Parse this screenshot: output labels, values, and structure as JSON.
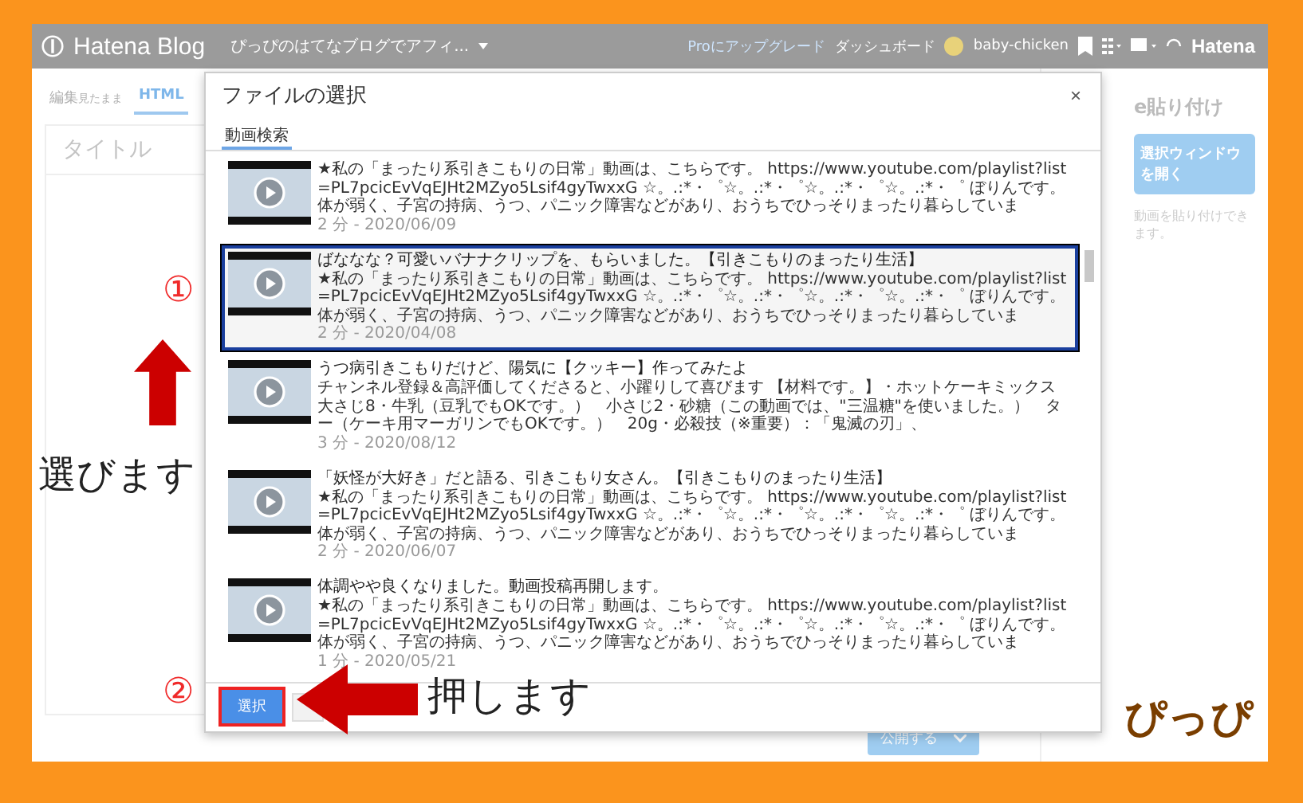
{
  "top_bar": {
    "logo": "Hatena Blog",
    "blog_title": "ぴっぴのはてなブログでアフィ...",
    "upgrade_link": "Proにアップグレード",
    "dashboard_link": "ダッシュボード",
    "user": "baby-chicken",
    "brand": "Hatena"
  },
  "editor": {
    "mode_tabs": [
      {
        "label": "編集",
        "sub": "見たまま",
        "selected": false
      },
      {
        "label": "HTML",
        "selected": true
      }
    ],
    "title_placeholder": "タイトル"
  },
  "side_panel": {
    "heading": "e貼り付け",
    "button": "選択ウィンドウを開く",
    "note": "動画を貼り付けできます。"
  },
  "publish_button": "公開する",
  "dialog": {
    "title": "ファイルの選択",
    "close": "×",
    "tabs": [
      {
        "label": "動画検索",
        "selected": true
      }
    ],
    "videos": [
      {
        "description": "★私の「まったり系引きこもりの日常」動画は、こちらです。 https://www.youtube.com/playlist?list=PL7pcicEvVqEJHt2MZyo5Lsif4gyTwxxG ☆。.:*・゜☆。.:*・゜☆。.:*・゜☆。.:*・゜ ぼりんです。体が弱く、子宮の持病、うつ、パニック障害などがあり、おうちでひっそりまったり暮らしていま",
        "meta": "2 分 - 2020/06/09",
        "selected": false
      },
      {
        "title": "ばななな？可愛いバナナクリップを、もらいました。【引きこもりのまったり生活】",
        "description": "★私の「まったり系引きこもりの日常」動画は、こちらです。 https://www.youtube.com/playlist?list=PL7pcicEvVqEJHt2MZyo5Lsif4gyTwxxG ☆。.:*・゜☆。.:*・゜☆。.:*・゜☆。.:*・゜ ぼりんです。体が弱く、子宮の持病、うつ、パニック障害などがあり、おうちでひっそりまったり暮らしていま",
        "meta": "2 分 - 2020/04/08",
        "selected": true
      },
      {
        "title": "うつ病引きこもりだけど、陽気に【クッキー】作ってみたよ",
        "description": "チャンネル登録＆高評価してくださると、小躍りして喜びます 【材料です。】・ホットケーキミックス大さじ8・牛乳（豆乳でもOKです。）　小さじ2・砂糖（この動画では、\"三温糖\"を使いました。）　ター（ケーキ用マーガリンでもOKです。）　20g・必殺技（※重要）：「鬼滅の刃」、",
        "meta": "3 分 - 2020/08/12",
        "selected": false
      },
      {
        "title": "「妖怪が大好き」だと語る、引きこもり女さん。【引きこもりのまったり生活】",
        "description": "★私の「まったり系引きこもりの日常」動画は、こちらです。 https://www.youtube.com/playlist?list=PL7pcicEvVqEJHt2MZyo5Lsif4gyTwxxG ☆。.:*・゜☆。.:*・゜☆。.:*・゜☆。.:*・゜ ぼりんです。体が弱く、子宮の持病、うつ、パニック障害などがあり、おうちでひっそりまったり暮らしていま",
        "meta": "2 分 - 2020/06/07",
        "selected": false
      },
      {
        "title": "体調やや良くなりました。動画投稿再開します。",
        "description": "★私の「まったり系引きこもりの日常」動画は、こちらです。 https://www.youtube.com/playlist?list=PL7pcicEvVqEJHt2MZyo5Lsif4gyTwxxG ☆。.:*・゜☆。.:*・゜☆。.:*・゜☆。.:*・゜ ぼりんです。体が弱く、子宮の持病、うつ、パニック障害などがあり、おうちでひっそりまったり暮らしていま",
        "meta": "1 分 - 2020/05/21",
        "selected": false
      }
    ],
    "select_button": "選択"
  },
  "annotations": {
    "step1_marker": "①",
    "step1_label": "選びます",
    "step2_marker": "②",
    "step2_label": "押します"
  },
  "signature": "ぴっぴ"
}
